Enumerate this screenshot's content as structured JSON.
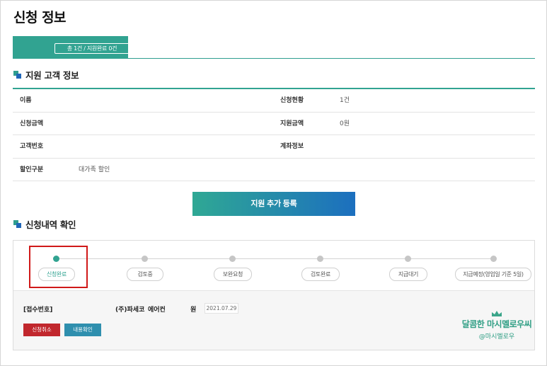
{
  "page": {
    "title": "신청 정보"
  },
  "tabs": [
    {
      "label": "총 1건 / 지원완료 0건",
      "active": true
    }
  ],
  "customer_section": {
    "title": "지원 고객 정보",
    "rows": [
      {
        "left_label": "이름",
        "left_value": "",
        "right_label": "신청현황",
        "right_value": "1건"
      },
      {
        "left_label": "신청금액",
        "left_value": "",
        "right_label": "지원금액",
        "right_value": "0원"
      },
      {
        "left_label": "고객번호",
        "left_value": "",
        "right_label": "계좌정보",
        "right_value": ""
      },
      {
        "left_label": "할인구분",
        "left_value": "대가족 할인",
        "right_label": "",
        "right_value": ""
      }
    ]
  },
  "add_button": {
    "label": "지원 추가 등록"
  },
  "history_section": {
    "title": "신청내역 확인",
    "steps": [
      {
        "label": "신청완료",
        "active": true
      },
      {
        "label": "검토중",
        "active": false
      },
      {
        "label": "보완요청",
        "active": false
      },
      {
        "label": "검토완료",
        "active": false
      },
      {
        "label": "지급대기",
        "active": false
      },
      {
        "label": "지급예정(영업일 기준 5일)",
        "active": false
      }
    ],
    "detail": {
      "receipt_label": "[접수번호]",
      "company": "(주)파세코",
      "product": "에어컨",
      "amount_unit": "원",
      "date": "2021.07.29",
      "cancel_label": "신청취소",
      "view_label": "내용확인"
    }
  },
  "watermark": {
    "title": "달콤한 마시멜로우씨",
    "handle": "@마시멜로우"
  },
  "colors": {
    "accent": "#31a391",
    "blue": "#1c6fbf",
    "cancel": "#c1272d",
    "highlight": "#d01919"
  }
}
